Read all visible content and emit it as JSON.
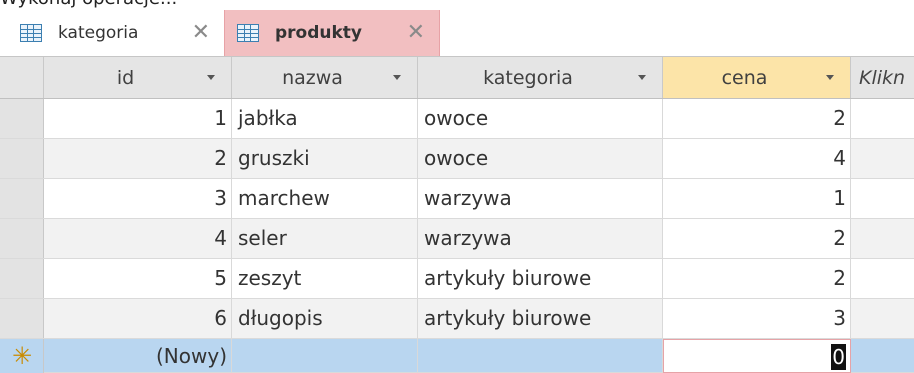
{
  "top_text": "Wykonaj operacje...",
  "tabs": [
    {
      "label": "kategoria",
      "close": "✕"
    },
    {
      "label": "produkty",
      "close": "✕"
    }
  ],
  "columns": {
    "id": "id",
    "nazwa": "nazwa",
    "kategoria": "kategoria",
    "cena": "cena",
    "add": "Klikn"
  },
  "rows": [
    {
      "id": "1",
      "nazwa": "jabłka",
      "kategoria": "owoce",
      "cena": "2"
    },
    {
      "id": "2",
      "nazwa": "gruszki",
      "kategoria": "owoce",
      "cena": "4"
    },
    {
      "id": "3",
      "nazwa": "marchew",
      "kategoria": "warzywa",
      "cena": "1"
    },
    {
      "id": "4",
      "nazwa": "seler",
      "kategoria": "warzywa",
      "cena": "2"
    },
    {
      "id": "5",
      "nazwa": "zeszyt",
      "kategoria": "artykuły biurowe",
      "cena": "2"
    },
    {
      "id": "6",
      "nazwa": "długopis",
      "kategoria": "artykuły biurowe",
      "cena": "3"
    }
  ],
  "new_row": {
    "id": "(Nowy)",
    "cena": "0",
    "marker": "✳"
  },
  "colors": {
    "selected_header": "#fce4a8",
    "active_tab": "#f2bfc1",
    "new_row": "#b9d6f0"
  }
}
